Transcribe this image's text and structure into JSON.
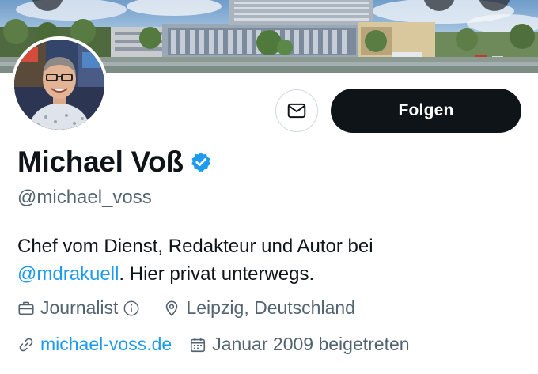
{
  "profile": {
    "display_name": "Michael Voß",
    "handle": "@michael_voss",
    "verified": true,
    "bio_prefix": "Chef vom Dienst, Redakteur und Autor bei",
    "bio_mention": "@mdrakuell",
    "bio_suffix": ". Hier privat unterwegs.",
    "category": "Journalist",
    "location": "Leipzig, Deutschland",
    "website": "michael-voss.de",
    "joined": "Januar 2009 beigetreten"
  },
  "actions": {
    "follow_label": "Folgen",
    "message_icon": "envelope-icon"
  },
  "colors": {
    "accent": "#1d9bf0",
    "text_primary": "#0f1419",
    "text_secondary": "#536471",
    "button_dark": "#0f1419"
  }
}
